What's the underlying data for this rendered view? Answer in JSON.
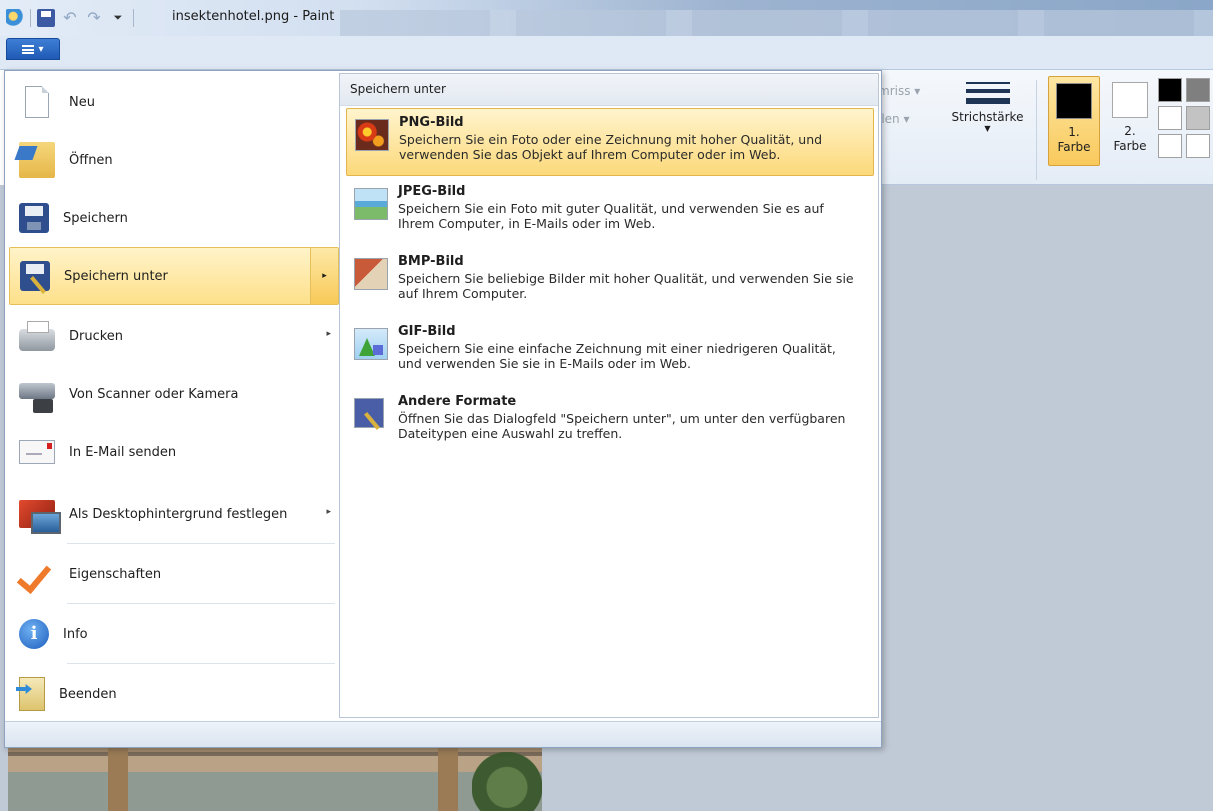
{
  "window": {
    "title": "insektenhotel.png - Paint",
    "quick_access_icons": [
      "paint-app-icon",
      "save-icon",
      "undo-icon",
      "redo-icon",
      "customize-qat-icon"
    ]
  },
  "ribbon": {
    "ghost_labels": [
      "mriss ▾",
      "llen ▾"
    ],
    "stroke_label": "Strichstärke",
    "color1_top": "1.",
    "color1_bottom": "Farbe",
    "color2_top": "2.",
    "color2_bottom": "Farbe",
    "color1_value": "#000000",
    "color2_value": "#ffffff",
    "palette": [
      "#000000",
      "#7f7f7f",
      "#ffffff",
      "#c3c3c3",
      "#ffffff",
      "#ffffff"
    ]
  },
  "app_menu": {
    "items": [
      {
        "label": "Neu",
        "icon": "new-document-icon"
      },
      {
        "label": "Öffnen",
        "icon": "open-folder-icon"
      },
      {
        "label": "Speichern",
        "icon": "save-icon"
      },
      {
        "label": "Speichern unter",
        "icon": "save-as-icon",
        "submenu": true,
        "highlighted": true
      },
      {
        "label": "Drucken",
        "icon": "printer-icon",
        "submenu": true
      },
      {
        "label": "Von Scanner oder Kamera",
        "icon": "scanner-camera-icon"
      },
      {
        "label": "In E-Mail senden",
        "icon": "email-icon"
      },
      {
        "label": "Als Desktophintergrund festlegen",
        "icon": "desktop-background-icon",
        "submenu": true
      },
      {
        "label": "Eigenschaften",
        "icon": "checkmark-icon"
      },
      {
        "label": "Info",
        "icon": "info-icon"
      },
      {
        "label": "Beenden",
        "icon": "exit-icon"
      }
    ]
  },
  "submenu": {
    "header": "Speichern unter",
    "items": [
      {
        "title": "PNG-Bild",
        "desc": "Speichern Sie ein Foto oder eine Zeichnung mit hoher Qualität, und verwenden Sie das Objekt auf Ihrem Computer oder im Web.",
        "icon": "png-image-icon",
        "highlighted": true
      },
      {
        "title": "JPEG-Bild",
        "desc": "Speichern Sie ein Foto mit guter Qualität, und verwenden Sie es auf Ihrem Computer, in E-Mails oder im Web.",
        "icon": "jpeg-image-icon"
      },
      {
        "title": "BMP-Bild",
        "desc": "Speichern Sie beliebige Bilder mit hoher Qualität, und verwenden Sie sie auf Ihrem Computer.",
        "icon": "bmp-image-icon"
      },
      {
        "title": "GIF-Bild",
        "desc": "Speichern Sie eine einfache Zeichnung mit einer niedrigeren Qualität, und verwenden Sie sie in E-Mails oder im Web.",
        "icon": "gif-image-icon"
      },
      {
        "title": "Andere Formate",
        "desc": "Öffnen Sie das Dialogfeld \"Speichern unter\", um unter den verfügbaren Dateitypen eine Auswahl zu treffen.",
        "icon": "other-formats-icon"
      }
    ]
  },
  "colors": {
    "highlight": "#fde08a",
    "highlight_border": "#e5bf59",
    "titlebar": "#d2dff0",
    "menu_button": "#1f5ab5"
  }
}
